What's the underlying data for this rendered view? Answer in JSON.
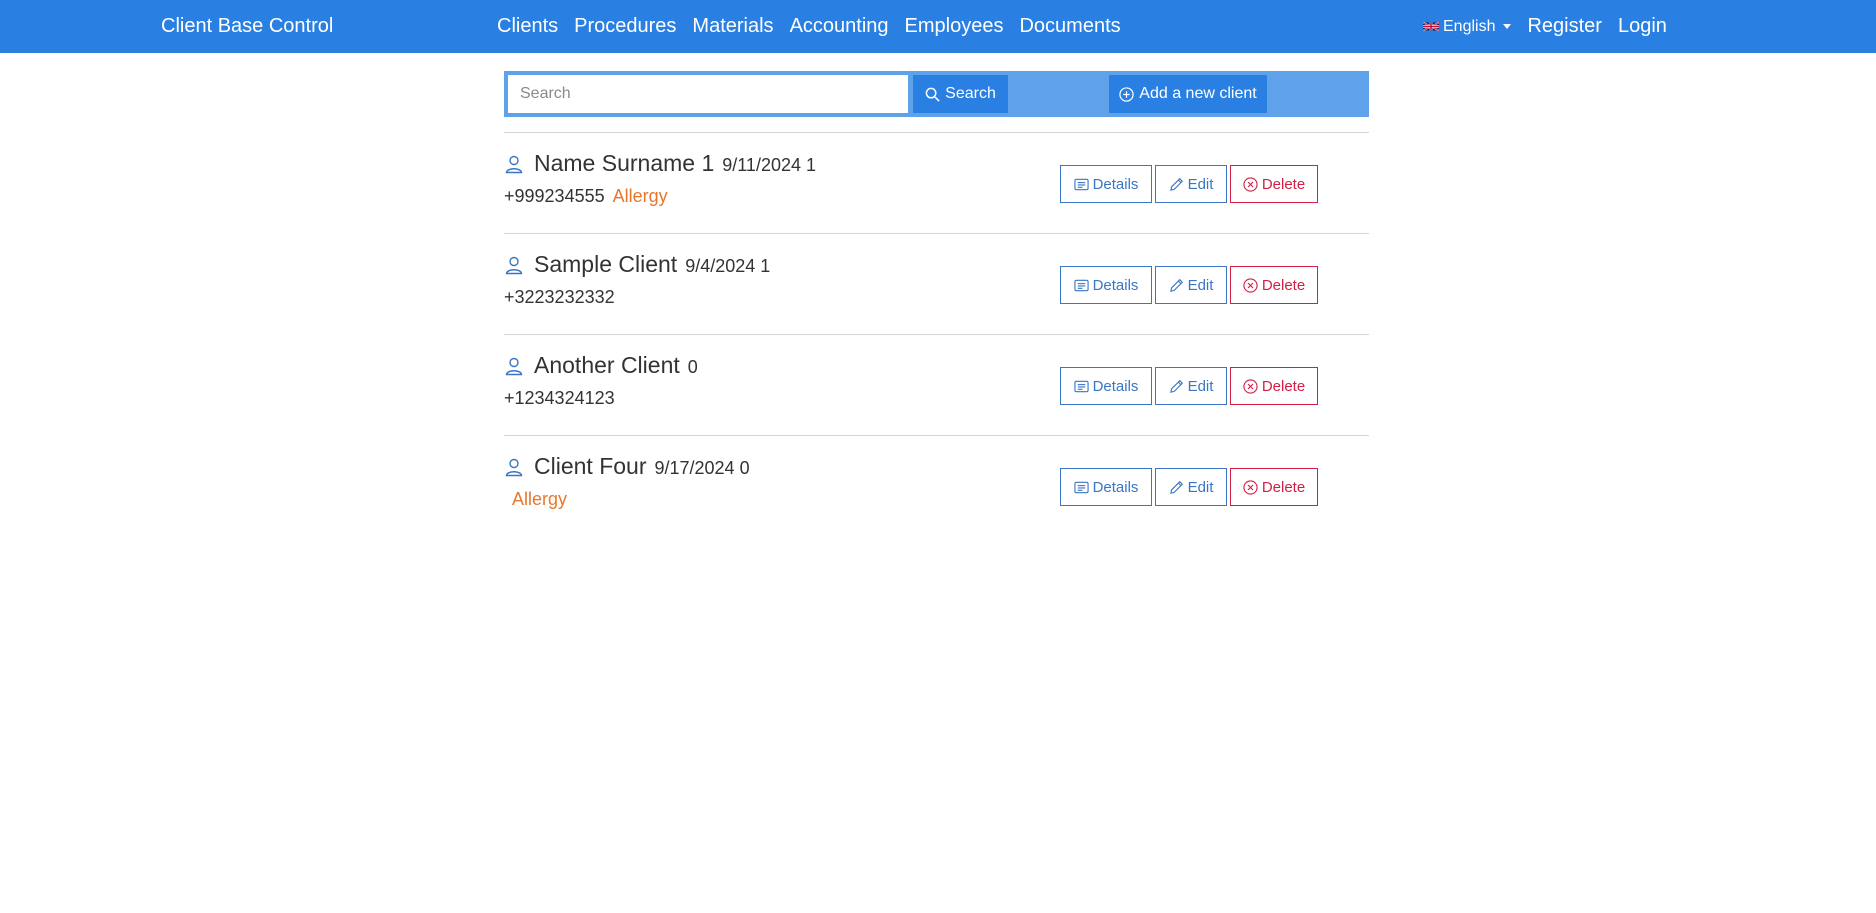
{
  "navbar": {
    "brand": "Client Base Control",
    "links": [
      "Clients",
      "Procedures",
      "Materials",
      "Accounting",
      "Employees",
      "Documents"
    ],
    "language": "English",
    "register": "Register",
    "login": "Login"
  },
  "toolbar": {
    "search_placeholder": "Search",
    "search_label": "Search",
    "add_label": "Add a new client"
  },
  "clients": [
    {
      "name": "Name Surname 1",
      "meta": "9/11/2024 1",
      "phone": "+999234555",
      "allergy": "Allergy"
    },
    {
      "name": "Sample Client",
      "meta": "9/4/2024 1",
      "phone": "+3223232332",
      "allergy": ""
    },
    {
      "name": "Another Client",
      "meta": "0",
      "phone": "+1234324123",
      "allergy": ""
    },
    {
      "name": "Client Four",
      "meta": "9/17/2024 0",
      "phone": "",
      "allergy": "Allergy"
    }
  ],
  "actions": {
    "details": "Details",
    "edit": "Edit",
    "delete": "Delete"
  },
  "colors": {
    "navbar": "#2a80e2",
    "searchbar": "#5fa2ea",
    "allergy": "#e8772e",
    "outline_blue": "#3a76c4",
    "danger": "#d21f46"
  },
  "icons": {
    "user": "person-icon",
    "search": "search-icon",
    "add": "plus-circle-icon",
    "details": "card-text-icon",
    "edit": "pencil-icon",
    "delete": "x-circle-icon",
    "flag": "uk-flag-icon"
  }
}
